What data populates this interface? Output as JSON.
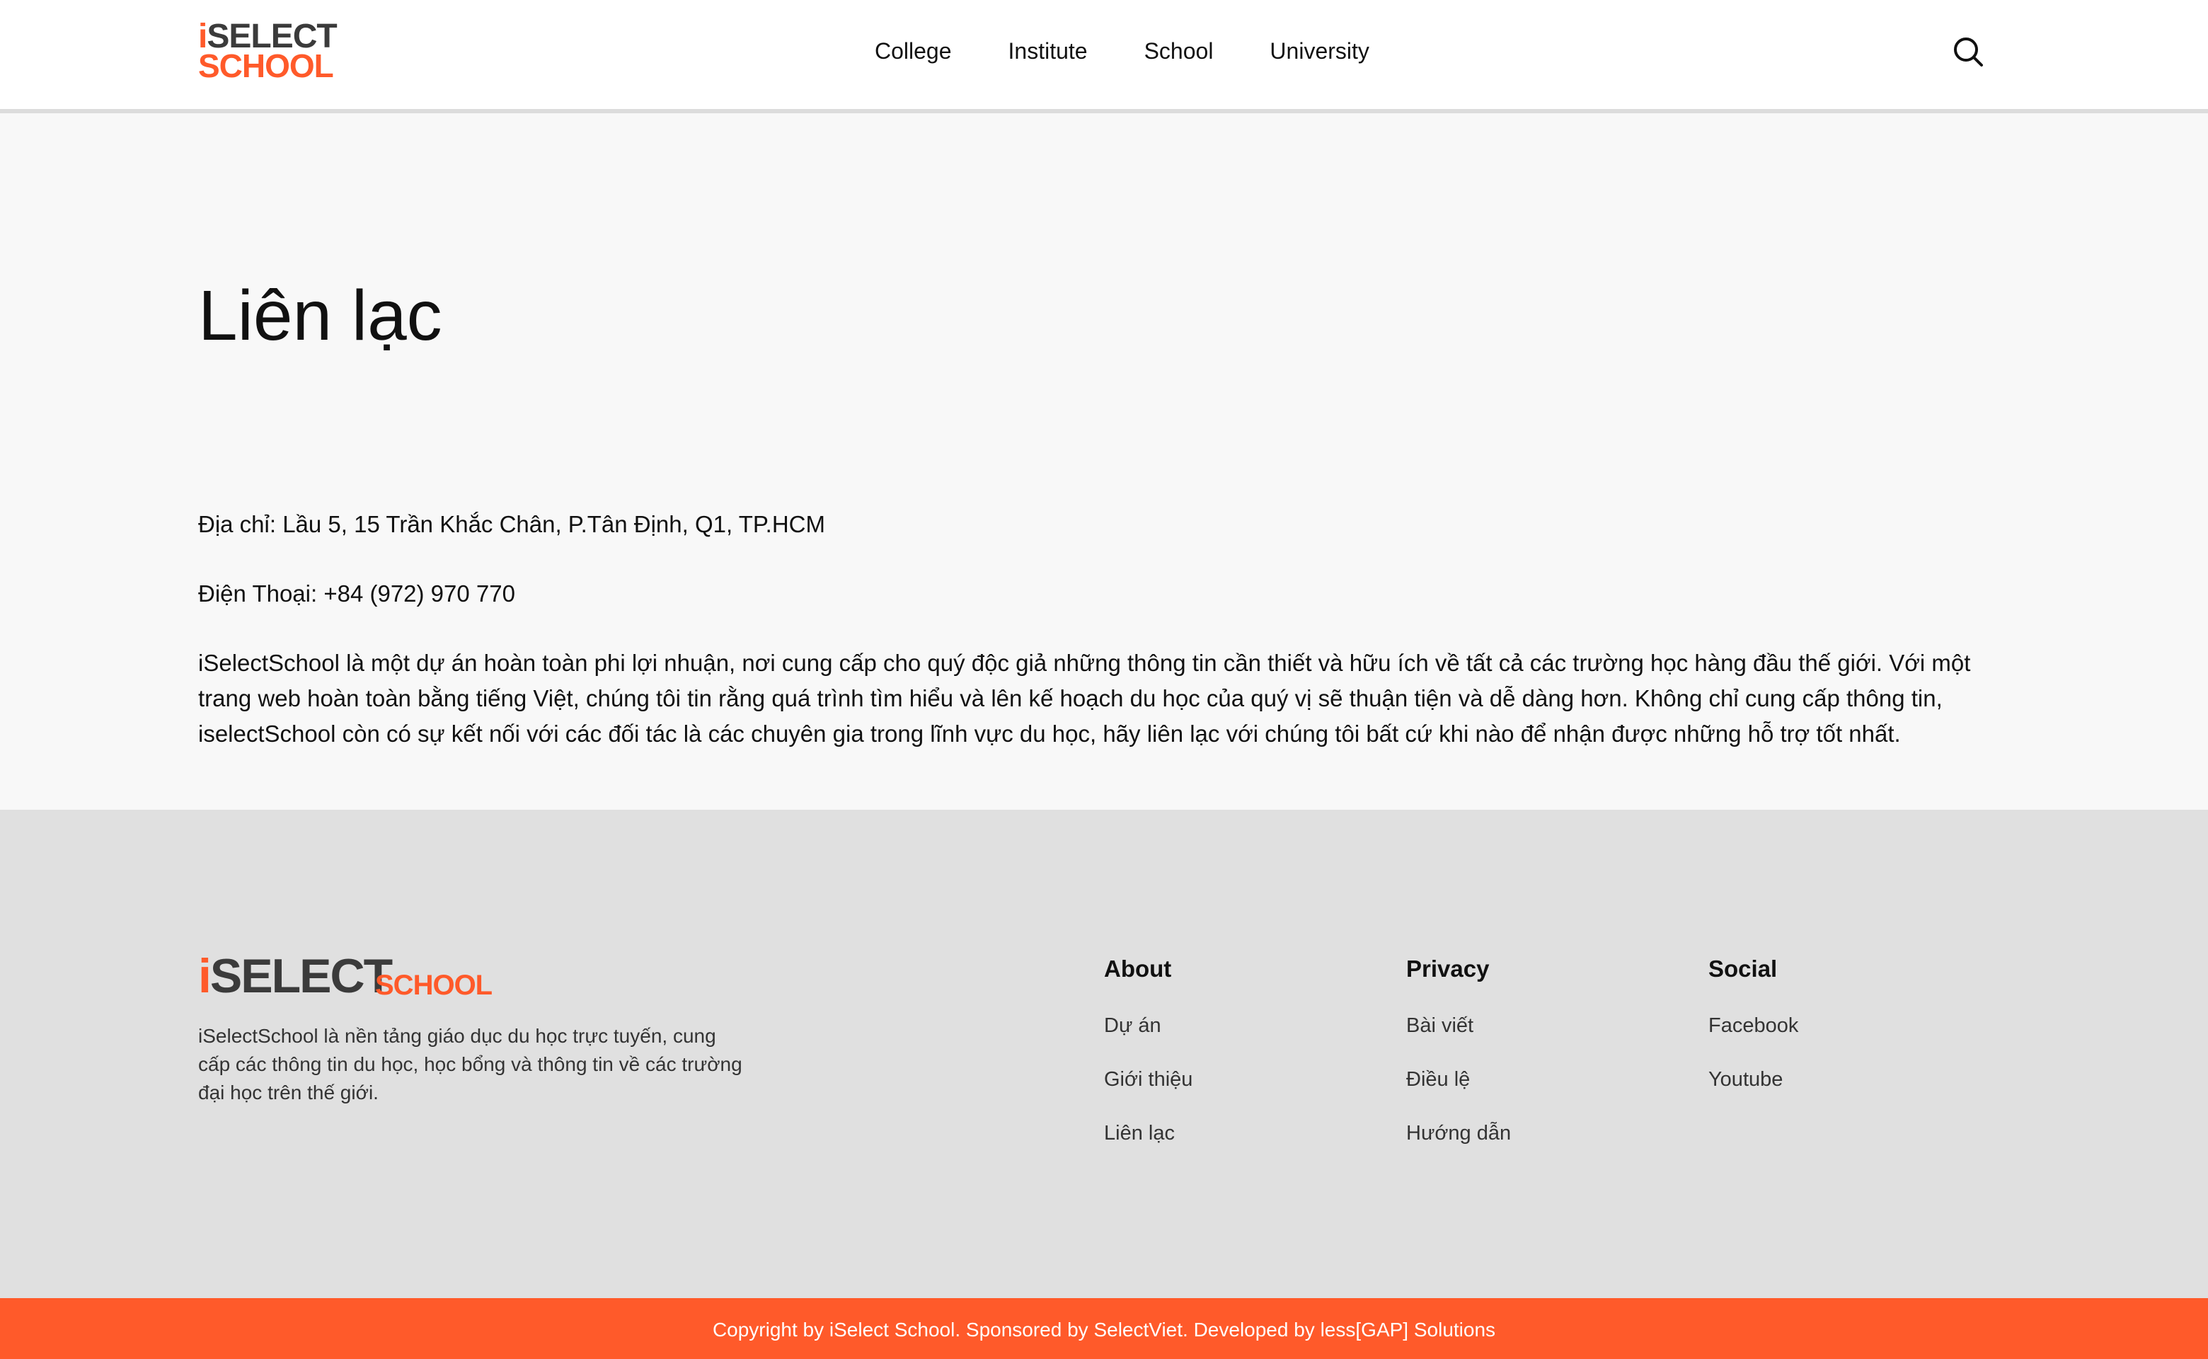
{
  "header": {
    "logo_line1_i": "i",
    "logo_line1": "SELECT",
    "logo_line2": "SCHOOL",
    "nav": [
      "College",
      "Institute",
      "School",
      "University"
    ],
    "search_icon": "search-icon"
  },
  "main": {
    "title": "Liên lạc",
    "address": "Địa chỉ: Lầu 5, 15 Trần Khắc Chân, P.Tân Định, Q1, TP.HCM",
    "phone": "Điện Thoại: +84 (972) 970 770",
    "description": "iSelectSchool là một dự án hoàn toàn phi lợi nhuận, nơi cung cấp cho quý độc giả những thông tin cần thiết và hữu ích về tất cả các trường học hàng đầu thế giới. Với một trang web hoàn toàn bằng tiếng Việt, chúng tôi tin rằng quá trình tìm hiểu và lên kế hoạch du học của quý vị sẽ thuận tiện và dễ dàng hơn. Không chỉ cung cấp thông tin, iselectSchool còn có sự kết nối với các đối tác là các chuyên gia trong lĩnh vực du học, hãy liên lạc với chúng tôi bất cứ khi nào để nhận được những hỗ trợ tốt nhất."
  },
  "footer": {
    "logo_i": "i",
    "logo_big": "SELECT",
    "logo_small": "SCHOOL",
    "description": "iSelectSchool là nền tảng giáo dục du học trực tuyến, cung cấp các thông tin du học, học bổng và thông tin về các trường đại học trên thế giới.",
    "columns": [
      {
        "title": "About",
        "links": [
          "Dự án",
          "Giới thiệu",
          "Liên lạc"
        ]
      },
      {
        "title": "Privacy",
        "links": [
          "Bài viết",
          "Điều lệ",
          "Hướng dẫn"
        ]
      },
      {
        "title": "Social",
        "links": [
          "Facebook",
          "Youtube"
        ]
      }
    ],
    "copyright": "Copyright by iSelect School. Sponsored by SelectViet. Developed by less[GAP] Solutions"
  },
  "colors": {
    "accent": "#ff5a2a",
    "logo_dark": "#3b3b3b",
    "header_bg": "#ffffff",
    "main_bg": "#f8f8f8",
    "footer_bg": "#e0e0e0"
  }
}
